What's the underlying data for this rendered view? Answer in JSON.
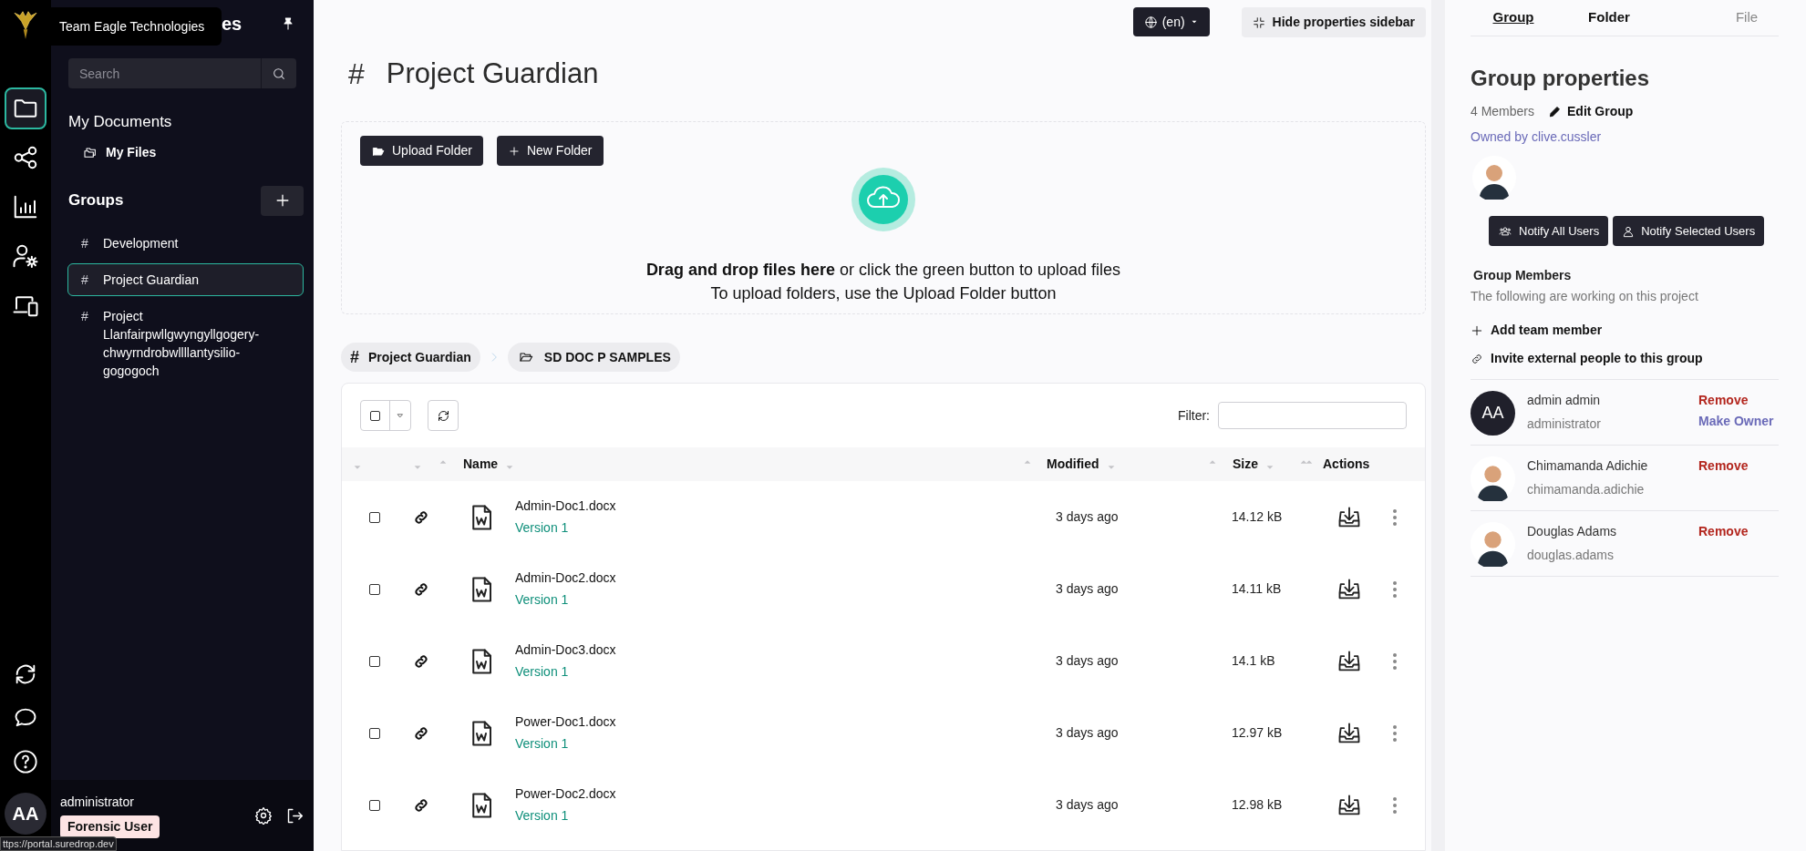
{
  "tooltip": "Team Eagle Technologies",
  "sidebar": {
    "title_visible": "es",
    "search": {
      "placeholder": "Search"
    },
    "my_documents": "My Documents",
    "my_files": "My Files",
    "groups_heading": "Groups",
    "groups": [
      {
        "icon": "#",
        "label": "Development",
        "selected": false
      },
      {
        "icon": "#",
        "label": "Project Guardian",
        "selected": true
      },
      {
        "icon": "#",
        "label": "Project Llanfairpwllgwyngyllgogery-chwyrndrobwllllantysilio-gogogoch",
        "selected": false
      }
    ],
    "user": {
      "initials": "AA",
      "name": "administrator",
      "role": "Forensic User"
    }
  },
  "rail": {
    "items": [
      {
        "kind": "folder",
        "selected": true
      },
      {
        "kind": "share",
        "selected": false
      },
      {
        "kind": "chart",
        "selected": false
      },
      {
        "kind": "user-settings",
        "selected": false
      },
      {
        "kind": "devices",
        "selected": false
      }
    ]
  },
  "status_url": "ttps://portal.suredrop.dev",
  "topbar": {
    "language": "(en)",
    "hide_sidebar": "Hide properties sidebar"
  },
  "page_title": {
    "icon": "#",
    "text": "Project Guardian"
  },
  "dropzone": {
    "buttons": [
      "Upload Folder",
      "New Folder"
    ],
    "line1": "**Drag and drop files here** or click the green button to upload files",
    "line2": "To upload folders, use the Upload Folder button"
  },
  "breadcrumbs": [
    {
      "kind": "group",
      "icon": "#",
      "label": "Project Guardian"
    },
    {
      "kind": "folder",
      "label": "SD DOC P SAMPLES"
    }
  ],
  "table": {
    "select_all": {
      "checked": false
    },
    "filter_label": "Filter:",
    "columns": [
      "",
      "",
      "Name",
      "Modified",
      "Size",
      "Actions"
    ],
    "rows": [
      {
        "checked": false,
        "name": "Admin-Doc1.docx",
        "version": "Version 1",
        "modified": "3 days ago",
        "size": "14.12 kB"
      },
      {
        "checked": false,
        "name": "Admin-Doc2.docx",
        "version": "Version 1",
        "modified": "3 days ago",
        "size": "14.11 kB"
      },
      {
        "checked": false,
        "name": "Admin-Doc3.docx",
        "version": "Version 1",
        "modified": "3 days ago",
        "size": "14.1 kB"
      },
      {
        "checked": false,
        "name": "Power-Doc1.docx",
        "version": "Version 1",
        "modified": "3 days ago",
        "size": "12.97 kB"
      },
      {
        "checked": false,
        "name": "Power-Doc2.docx",
        "version": "Version 1",
        "modified": "3 days ago",
        "size": "12.98 kB"
      }
    ]
  },
  "properties": {
    "tabs": [
      {
        "label": "Group",
        "selected": true,
        "disabled": false
      },
      {
        "label": "Folder",
        "selected": false,
        "disabled": false
      },
      {
        "label": "File",
        "selected": false,
        "disabled": true
      }
    ],
    "title": "Group properties",
    "members_count": "4 Members",
    "edit_group": "Edit Group",
    "owner": "Owned by clive.cussler",
    "notify_buttons": [
      {
        "kind": "all",
        "label": "Notify All Users"
      },
      {
        "kind": "selected",
        "label": "Notify Selected Users"
      }
    ],
    "members_heading": "Group Members",
    "members_subtitle": "The following are working on this project",
    "links": [
      {
        "kind": "add",
        "label": "Add team member"
      },
      {
        "kind": "invite",
        "label": "Invite external people to this group"
      }
    ],
    "members": [
      {
        "kind": "initials",
        "initials": "AA",
        "name": "admin admin",
        "username": "administrator",
        "actions": [
          {
            "kind": "remove",
            "label": "Remove"
          },
          {
            "kind": "make_owner",
            "label": "Make Owner"
          }
        ]
      },
      {
        "kind": "picture",
        "name": "Chimamanda Adichie",
        "username": "chimamanda.adichie",
        "actions": [
          {
            "kind": "remove",
            "label": "Remove"
          }
        ]
      },
      {
        "kind": "picture",
        "name": "Douglas Adams",
        "username": "douglas.adams",
        "actions": [
          {
            "kind": "remove",
            "label": "Remove"
          }
        ]
      }
    ]
  }
}
